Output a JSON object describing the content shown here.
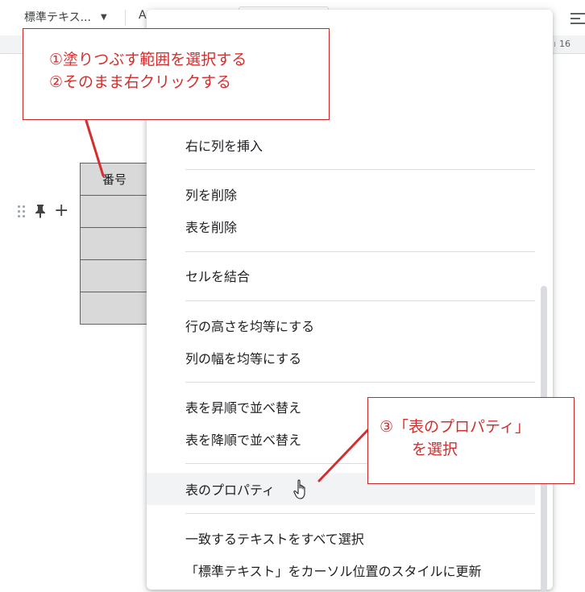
{
  "toolbar": {
    "style_value": "標準テキス...",
    "font_value": "A"
  },
  "ruler": {
    "visible_number": "16"
  },
  "table": {
    "header_cell": "番号",
    "rows": [
      "",
      "",
      "",
      ""
    ]
  },
  "context_menu": {
    "items": [
      "右に列を挿入",
      "列を削除",
      "表を削除",
      "セルを結合",
      "行の高さを均等にする",
      "列の幅を均等にする",
      "表を昇順で並べ替え",
      "表を降順で並べ替え",
      "表のプロパティ",
      "一致するテキストをすべて選択",
      "「標準テキスト」をカーソル位置のスタイルに更新"
    ],
    "hovered_index": 8
  },
  "callouts": {
    "step1_line1": "①塗りつぶす範囲を選択する",
    "step1_line2": "②そのまま右クリックする",
    "step3_line1": "③「表のプロパティ」",
    "step3_line2": "を選択"
  },
  "colors": {
    "annotation_red": "#d32f2f",
    "cell_fill": "#d9d9d9",
    "menu_hover": "#f1f3f4"
  }
}
